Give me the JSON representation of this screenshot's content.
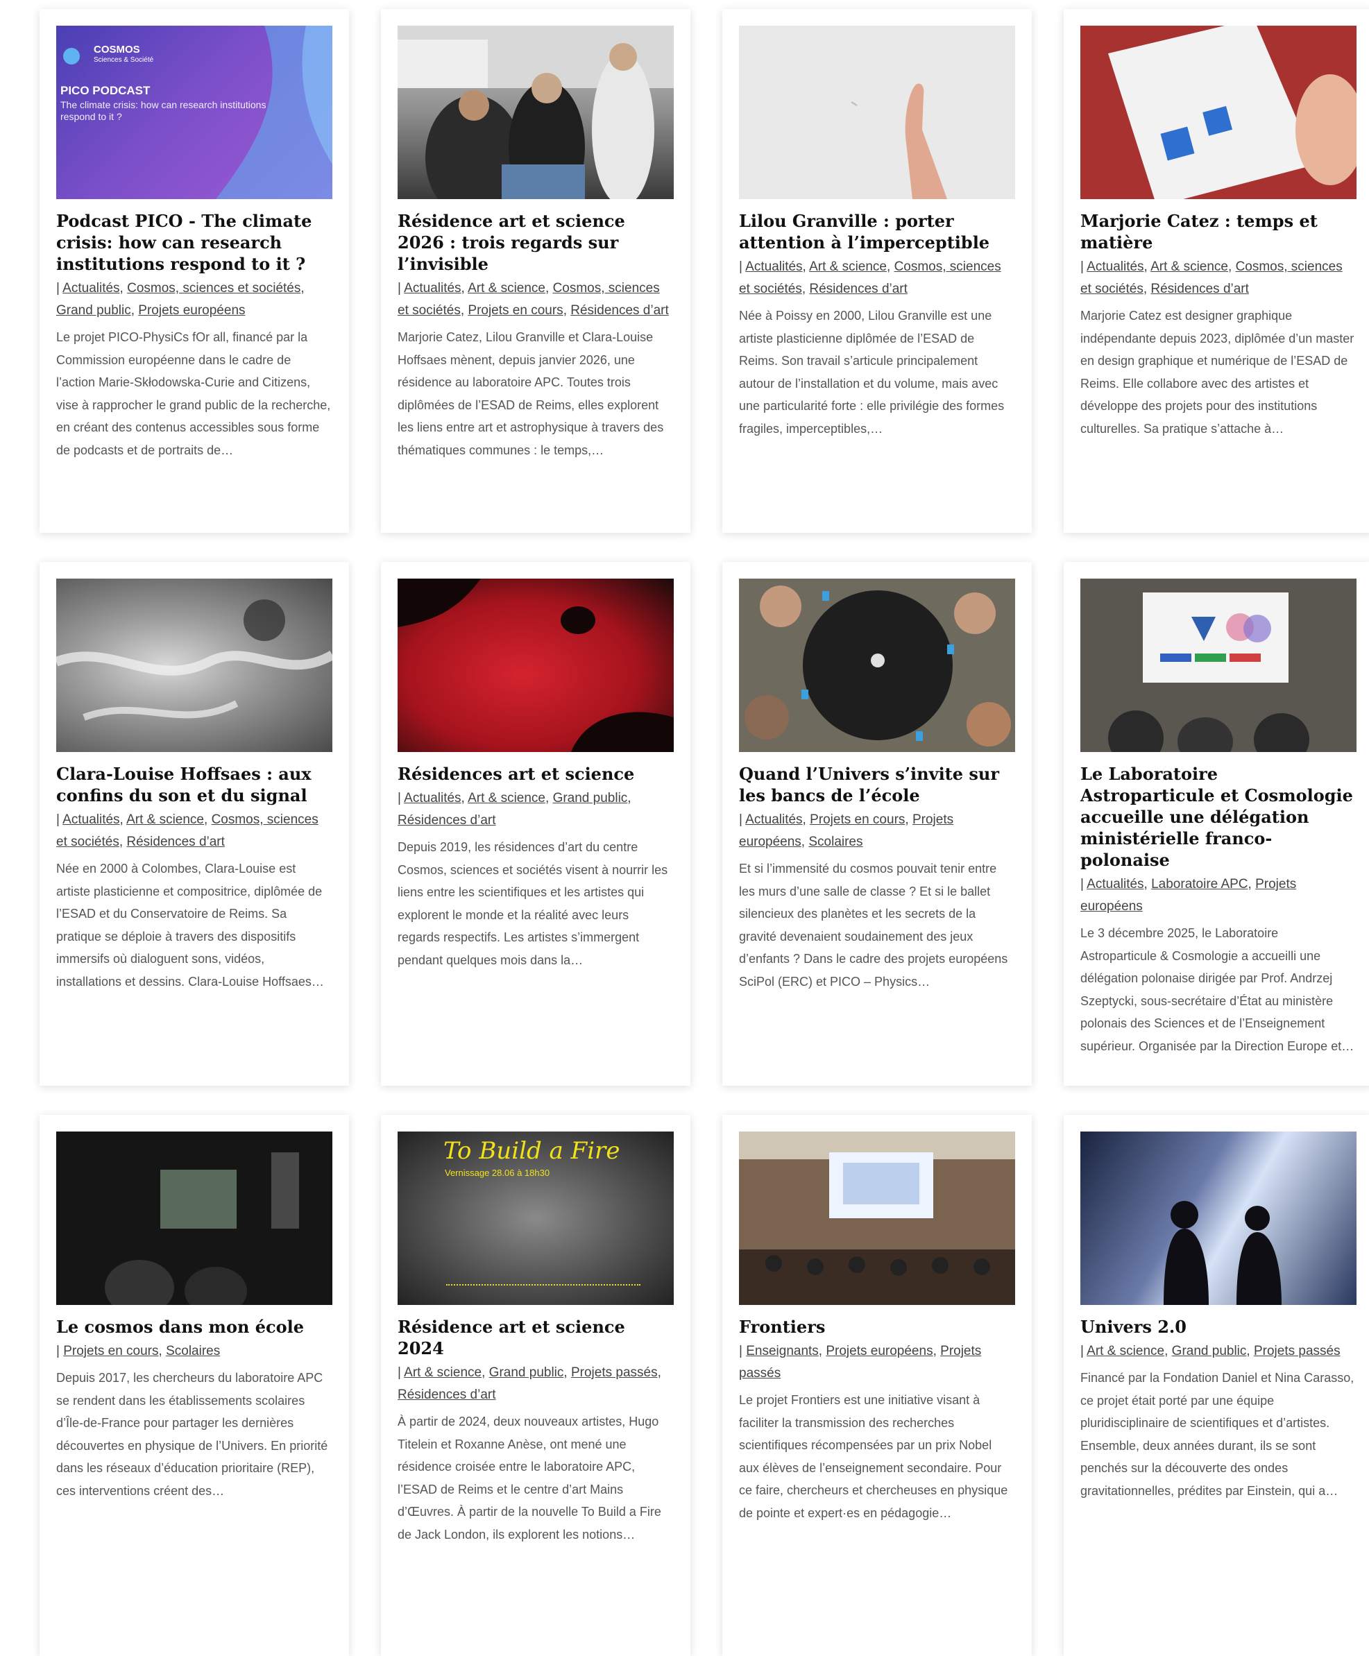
{
  "cards": [
    {
      "title": "Podcast PICO - The climate crisis: how can research institutions respond to it ?",
      "categories": [
        "Actualités",
        "Cosmos, sciences et sociétés",
        "Grand public",
        "Projets européens"
      ],
      "excerpt": "Le projet PICO-PhysiCs fOr all, financé par la Commission européenne dans le cadre de l’action Marie-Skłodowska-Curie and Citizens, vise à rapprocher le grand public de la recherche, en créant des contenus accessibles sous forme de podcasts et de portraits de…",
      "thumb": {
        "brand": "COSMOS",
        "brand_sub": "Sciences & Société",
        "heading": "PICO PODCAST",
        "subheading": "The climate crisis: how can research institutions respond to it ?"
      }
    },
    {
      "title": "Résidence art et science 2026 : trois regards sur l’invisible",
      "categories": [
        "Actualités",
        "Art & science",
        "Cosmos, sciences et sociétés",
        "Projets en cours",
        "Résidences d’art"
      ],
      "excerpt": "Marjorie Catez, Lilou Granville et Clara-Louise Hoffsaes mènent, depuis janvier 2026, une résidence au laboratoire APC. Toutes trois diplômées de l’ESAD de Reims, elles explorent les liens entre art et astrophysique à travers des thématiques communes : le temps,…"
    },
    {
      "title": "Lilou Granville : porter attention à l’imperceptible",
      "categories": [
        "Actualités",
        "Art & science",
        "Cosmos, sciences et sociétés",
        "Résidences d’art"
      ],
      "excerpt": "Née à Poissy en 2000, Lilou Granville est une artiste plasticienne diplômée de l’ESAD de Reims. Son travail s’articule principalement autour de l’installation et du volume, mais avec une particularité forte : elle privilégie des formes fragiles, imperceptibles,…"
    },
    {
      "title": "Marjorie Catez : temps et matière",
      "categories": [
        "Actualités",
        "Art & science",
        "Cosmos, sciences et sociétés",
        "Résidences d’art"
      ],
      "excerpt": "Marjorie Catez est designer graphique indépendante depuis 2023, diplômée d’un master en design graphique et numérique de l’ESAD de Reims. Elle collabore avec des artistes et développe des projets pour des institutions culturelles. Sa pratique s’attache à…"
    },
    {
      "title": "Clara-Louise Hoffsaes : aux confins du son et du signal",
      "categories": [
        "Actualités",
        "Art & science",
        "Cosmos, sciences et sociétés",
        "Résidences d’art"
      ],
      "excerpt": "Née en 2000 à Colombes, Clara-Louise est artiste plasticienne et compositrice, diplômée de l’ESAD et du Conservatoire de Reims. Sa pratique se déploie à travers des dispositifs immersifs où dialoguent sons, vidéos, installations et dessins. Clara-Louise Hoffsaes…"
    },
    {
      "title": "Résidences art et science",
      "categories": [
        "Actualités",
        "Art & science",
        "Grand public",
        "Résidences d’art"
      ],
      "excerpt": "Depuis 2019, les résidences d’art du centre Cosmos, sciences et sociétés visent à nourrir les liens entre les scientifiques et les artistes qui explorent le monde et la réalité avec leurs regards respectifs. Les artistes s’immergent pendant quelques mois dans la…"
    },
    {
      "title": "Quand l’Univers s’invite sur les bancs de l’école",
      "categories": [
        "Actualités",
        "Projets en cours",
        "Projets européens",
        "Scolaires"
      ],
      "excerpt": "Et si l’immensité du cosmos pouvait tenir entre les murs d’une salle de classe ? Et si le ballet silencieux des planètes et les secrets de la gravité devenaient soudainement des jeux d’enfants ? Dans le cadre des projets européens SciPol (ERC) et PICO – Physics…"
    },
    {
      "title": "Le Laboratoire Astroparticule et Cosmologie accueille une délégation ministérielle franco-polonaise",
      "categories": [
        "Actualités",
        "Laboratoire APC",
        "Projets européens"
      ],
      "excerpt": "Le 3 décembre 2025, le Laboratoire Astroparticule & Cosmologie a accueilli une délégation polonaise dirigée par Prof. Andrzej Szeptycki, sous-secrétaire d’État au ministère polonais des Sciences et de l’Enseignement supérieur. Organisée par la Direction Europe et…"
    },
    {
      "title": "Le cosmos dans mon école",
      "categories": [
        "Projets en cours",
        "Scolaires"
      ],
      "excerpt": "Depuis 2017, les chercheurs du laboratoire APC se rendent dans les établissements scolaires d’Île-de-France pour partager les dernières découvertes en physique de l’Univers. En priorité dans les réseaux d’éducation prioritaire (REP), ces interventions créent des…"
    },
    {
      "title": "Résidence art et science 2024",
      "categories": [
        "Art & science",
        "Grand public",
        "Projets passés",
        "Résidences d’art"
      ],
      "excerpt": "À partir de 2024, deux nouveaux artistes, Hugo Titelein et Roxanne Anèse, ont mené une résidence croisée entre le laboratoire APC, l’ESAD de Reims et le centre d’art Mains d’Œuvres. À partir de la nouvelle To Build a Fire de Jack London, ils explorent les notions…",
      "thumb": {
        "heading": "To Build a Fire",
        "subheading": "Vernissage 28.06 à 18h30"
      }
    },
    {
      "title": "Frontiers",
      "categories": [
        "Enseignants",
        "Projets européens",
        "Projets passés"
      ],
      "excerpt": "Le projet Frontiers est une initiative visant à faciliter la transmission des recherches scientifiques récompensées par un prix Nobel aux élèves de l’enseignement secondaire. Pour ce faire, chercheurs et chercheuses en physique de pointe et expert·es en pédagogie…"
    },
    {
      "title": "Univers 2.0",
      "categories": [
        "Art & science",
        "Grand public",
        "Projets passés"
      ],
      "excerpt": "Financé par la Fondation Daniel et Nina Carasso, ce projet était porté par une équipe pluridisciplinaire de scientifiques et d’artistes. Ensemble, deux années durant, ils se sont penchés sur la découverte des ondes gravitationnelles, prédites par Einstein, qui a…"
    }
  ]
}
